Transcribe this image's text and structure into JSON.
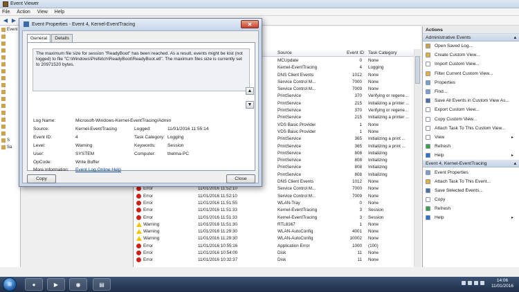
{
  "window": {
    "title": "Event Viewer"
  },
  "menu": [
    "File",
    "Action",
    "View",
    "Help"
  ],
  "tree": {
    "items": [
      "Event",
      "",
      "",
      "",
      "",
      "",
      "",
      "",
      "",
      "",
      "",
      "",
      "",
      "",
      "",
      "",
      "S",
      "Sa"
    ]
  },
  "list": {
    "columns": [
      "Source",
      "Event ID",
      "Task Category"
    ],
    "rows": [
      {
        "level": "",
        "date": "",
        "source": "MCUpdate",
        "id": "0",
        "task": "None",
        "icon": "info"
      },
      {
        "level": "",
        "date": "",
        "source": "Kernel-EventTracing",
        "id": "4",
        "task": "Logging",
        "icon": "warn"
      },
      {
        "level": "",
        "date": "",
        "source": "DNS Client Events",
        "id": "1012",
        "task": "None",
        "icon": "err"
      },
      {
        "level": "",
        "date": "",
        "source": "Service Control M...",
        "id": "7000",
        "task": "None",
        "icon": "err"
      },
      {
        "level": "",
        "date": "",
        "source": "Service Control M...",
        "id": "7009",
        "task": "None",
        "icon": "err"
      },
      {
        "level": "",
        "date": "",
        "source": "PrintService",
        "id": "370",
        "task": "Verifying or regene...",
        "icon": "err"
      },
      {
        "level": "",
        "date": "",
        "source": "PrintService",
        "id": "215",
        "task": "Initializing a printer ...",
        "icon": "err"
      },
      {
        "level": "",
        "date": "",
        "source": "PrintService",
        "id": "370",
        "task": "Verifying or regene...",
        "icon": "err"
      },
      {
        "level": "",
        "date": "",
        "source": "PrintService",
        "id": "215",
        "task": "Initializing a printer ...",
        "icon": "err"
      },
      {
        "level": "",
        "date": "",
        "source": "VDS Basic Provider",
        "id": "1",
        "task": "None",
        "icon": "err"
      },
      {
        "level": "",
        "date": "",
        "source": "VDS Basic Provider",
        "id": "1",
        "task": "None",
        "icon": "err"
      },
      {
        "level": "",
        "date": "",
        "source": "PrintService",
        "id": "365",
        "task": "Initializing a print ...",
        "icon": "err"
      },
      {
        "level": "",
        "date": "",
        "source": "PrintService",
        "id": "365",
        "task": "Initializing a print ...",
        "icon": "err"
      },
      {
        "level": "",
        "date": "",
        "source": "PrintService",
        "id": "808",
        "task": "Initializing",
        "icon": "err"
      },
      {
        "level": "",
        "date": "",
        "source": "PrintService",
        "id": "808",
        "task": "Initializing",
        "icon": "err"
      },
      {
        "level": "",
        "date": "",
        "source": "PrintService",
        "id": "808",
        "task": "Initializing",
        "icon": "err"
      },
      {
        "level": "",
        "date": "",
        "source": "PrintService",
        "id": "808",
        "task": "Initializing",
        "icon": "err"
      },
      {
        "level": "",
        "date": "",
        "source": "DNS Client Events",
        "id": "1012",
        "task": "None",
        "icon": "err"
      },
      {
        "level": "Error",
        "date": "11/01/2016 11:52:10",
        "source": "Service Control M...",
        "id": "7000",
        "task": "None",
        "icon": "err"
      },
      {
        "level": "Error",
        "date": "11/01/2016 11:52:10",
        "source": "Service Control M...",
        "id": "7009",
        "task": "None",
        "icon": "err"
      },
      {
        "level": "Error",
        "date": "11/01/2016 11:51:55",
        "source": "WLAN-Tray",
        "id": "0",
        "task": "None",
        "icon": "err"
      },
      {
        "level": "Error",
        "date": "11/01/2016 11:51:33",
        "source": "Kernel-EventTracing",
        "id": "3",
        "task": "Session",
        "icon": "err"
      },
      {
        "level": "Error",
        "date": "11/01/2016 11:51:33",
        "source": "Kernel-EventTracing",
        "id": "3",
        "task": "Session",
        "icon": "err"
      },
      {
        "level": "Warning",
        "date": "11/01/2016 11:51:30",
        "source": "RTL8167",
        "id": "1",
        "task": "None",
        "icon": "warn"
      },
      {
        "level": "Warning",
        "date": "11/01/2016 11:29:30",
        "source": "WLAN-AutoConfig",
        "id": "4001",
        "task": "None",
        "icon": "warn"
      },
      {
        "level": "Warning",
        "date": "11/01/2016 11:29:30",
        "source": "WLAN-AutoConfig",
        "id": "10002",
        "task": "None",
        "icon": "warn"
      },
      {
        "level": "Error",
        "date": "11/01/2016 10:55:16",
        "source": "Application Error",
        "id": "1000",
        "task": "(100)",
        "icon": "err"
      },
      {
        "level": "Error",
        "date": "11/01/2016 10:54:00",
        "source": "Disk",
        "id": "11",
        "task": "None",
        "icon": "err"
      },
      {
        "level": "Error",
        "date": "11/01/2016 10:32:37",
        "source": "Disk",
        "id": "11",
        "task": "None",
        "icon": "err"
      }
    ]
  },
  "actions": {
    "title": "Actions",
    "section1": "Administrative Events",
    "items1": [
      {
        "label": "Open Saved Log...",
        "icon": "open-log-icon",
        "color": "#c9a34d"
      },
      {
        "label": "Create Custom View...",
        "icon": "filter-icon",
        "color": "#e2b33c"
      },
      {
        "label": "Import Custom View...",
        "icon": "import-icon",
        "color": "#ffffff"
      },
      {
        "label": "Filter Current Custom View...",
        "icon": "filter-icon",
        "color": "#e2b33c"
      },
      {
        "label": "Properties",
        "icon": "properties-icon",
        "color": "#7aa0cf"
      },
      {
        "label": "Find...",
        "icon": "find-icon",
        "color": "#7aa0cf"
      },
      {
        "label": "Save All Events in Custom View As...",
        "icon": "save-icon",
        "color": "#4b6fa8"
      },
      {
        "label": "Export Custom View...",
        "icon": "export-icon",
        "color": "#ffffff"
      },
      {
        "label": "Copy Custom View...",
        "icon": "copy-icon",
        "color": "#ffffff"
      },
      {
        "label": "Attach Task To This Custom View...",
        "icon": "task-icon",
        "color": "#ffffff"
      },
      {
        "label": "View",
        "icon": "view-icon",
        "color": "#ffffff"
      },
      {
        "label": "Refresh",
        "icon": "refresh-icon",
        "color": "#3aa04a"
      },
      {
        "label": "Help",
        "icon": "help-icon",
        "color": "#2f6fcf"
      }
    ],
    "section2": "Event 4, Kernel-EventTracing",
    "items2": [
      {
        "label": "Event Properties",
        "icon": "properties-icon",
        "color": "#7aa0cf"
      },
      {
        "label": "Attach Task To This Event...",
        "icon": "task-icon",
        "color": "#e2b33c"
      },
      {
        "label": "Save Selected Events...",
        "icon": "save-icon",
        "color": "#4b6fa8"
      },
      {
        "label": "Copy",
        "icon": "copy-icon",
        "color": "#ffffff"
      },
      {
        "label": "Refresh",
        "icon": "refresh-icon",
        "color": "#3aa04a"
      },
      {
        "label": "Help",
        "icon": "help-icon",
        "color": "#2f6fcf"
      }
    ]
  },
  "dialog": {
    "title": "Event Properties - Event 4, Kernel-EventTracing",
    "tabs": [
      "General",
      "Details"
    ],
    "message": "The maximum file size for session \"ReadyBoot\" has been reached. As a result, events might be lost (not logged) to file \"C:\\Windows\\Prefetch\\ReadyBoot\\ReadyBoot.etl\". The maximum files size is currently set to 20971520 bytes.",
    "labels": {
      "log_name": "Log Name:",
      "source": "Source:",
      "event_id": "Event ID:",
      "level": "Level:",
      "user": "User:",
      "opcode": "OpCode:",
      "more_info": "More Information:",
      "logged": "Logged:",
      "task_category": "Task Category:",
      "keywords": "Keywords:",
      "computer": "Computer:"
    },
    "values": {
      "log_name": "Microsoft-Windows-Kernel-EventTracing/Admin",
      "source": "Kernel-EventTracing",
      "event_id": "4",
      "level": "Warning",
      "user": "SYSTEM",
      "opcode": "Write Buffer",
      "more_info_link": "Event Log Online Help",
      "logged": "11/01/2016 11:55:14",
      "task_category": "Logging",
      "keywords": "Session",
      "computer": "thelma-PC"
    },
    "copy_label": "Copy",
    "close_label": "Close"
  },
  "taskbar": {
    "time": "14:06",
    "date": "11/01/2016"
  }
}
